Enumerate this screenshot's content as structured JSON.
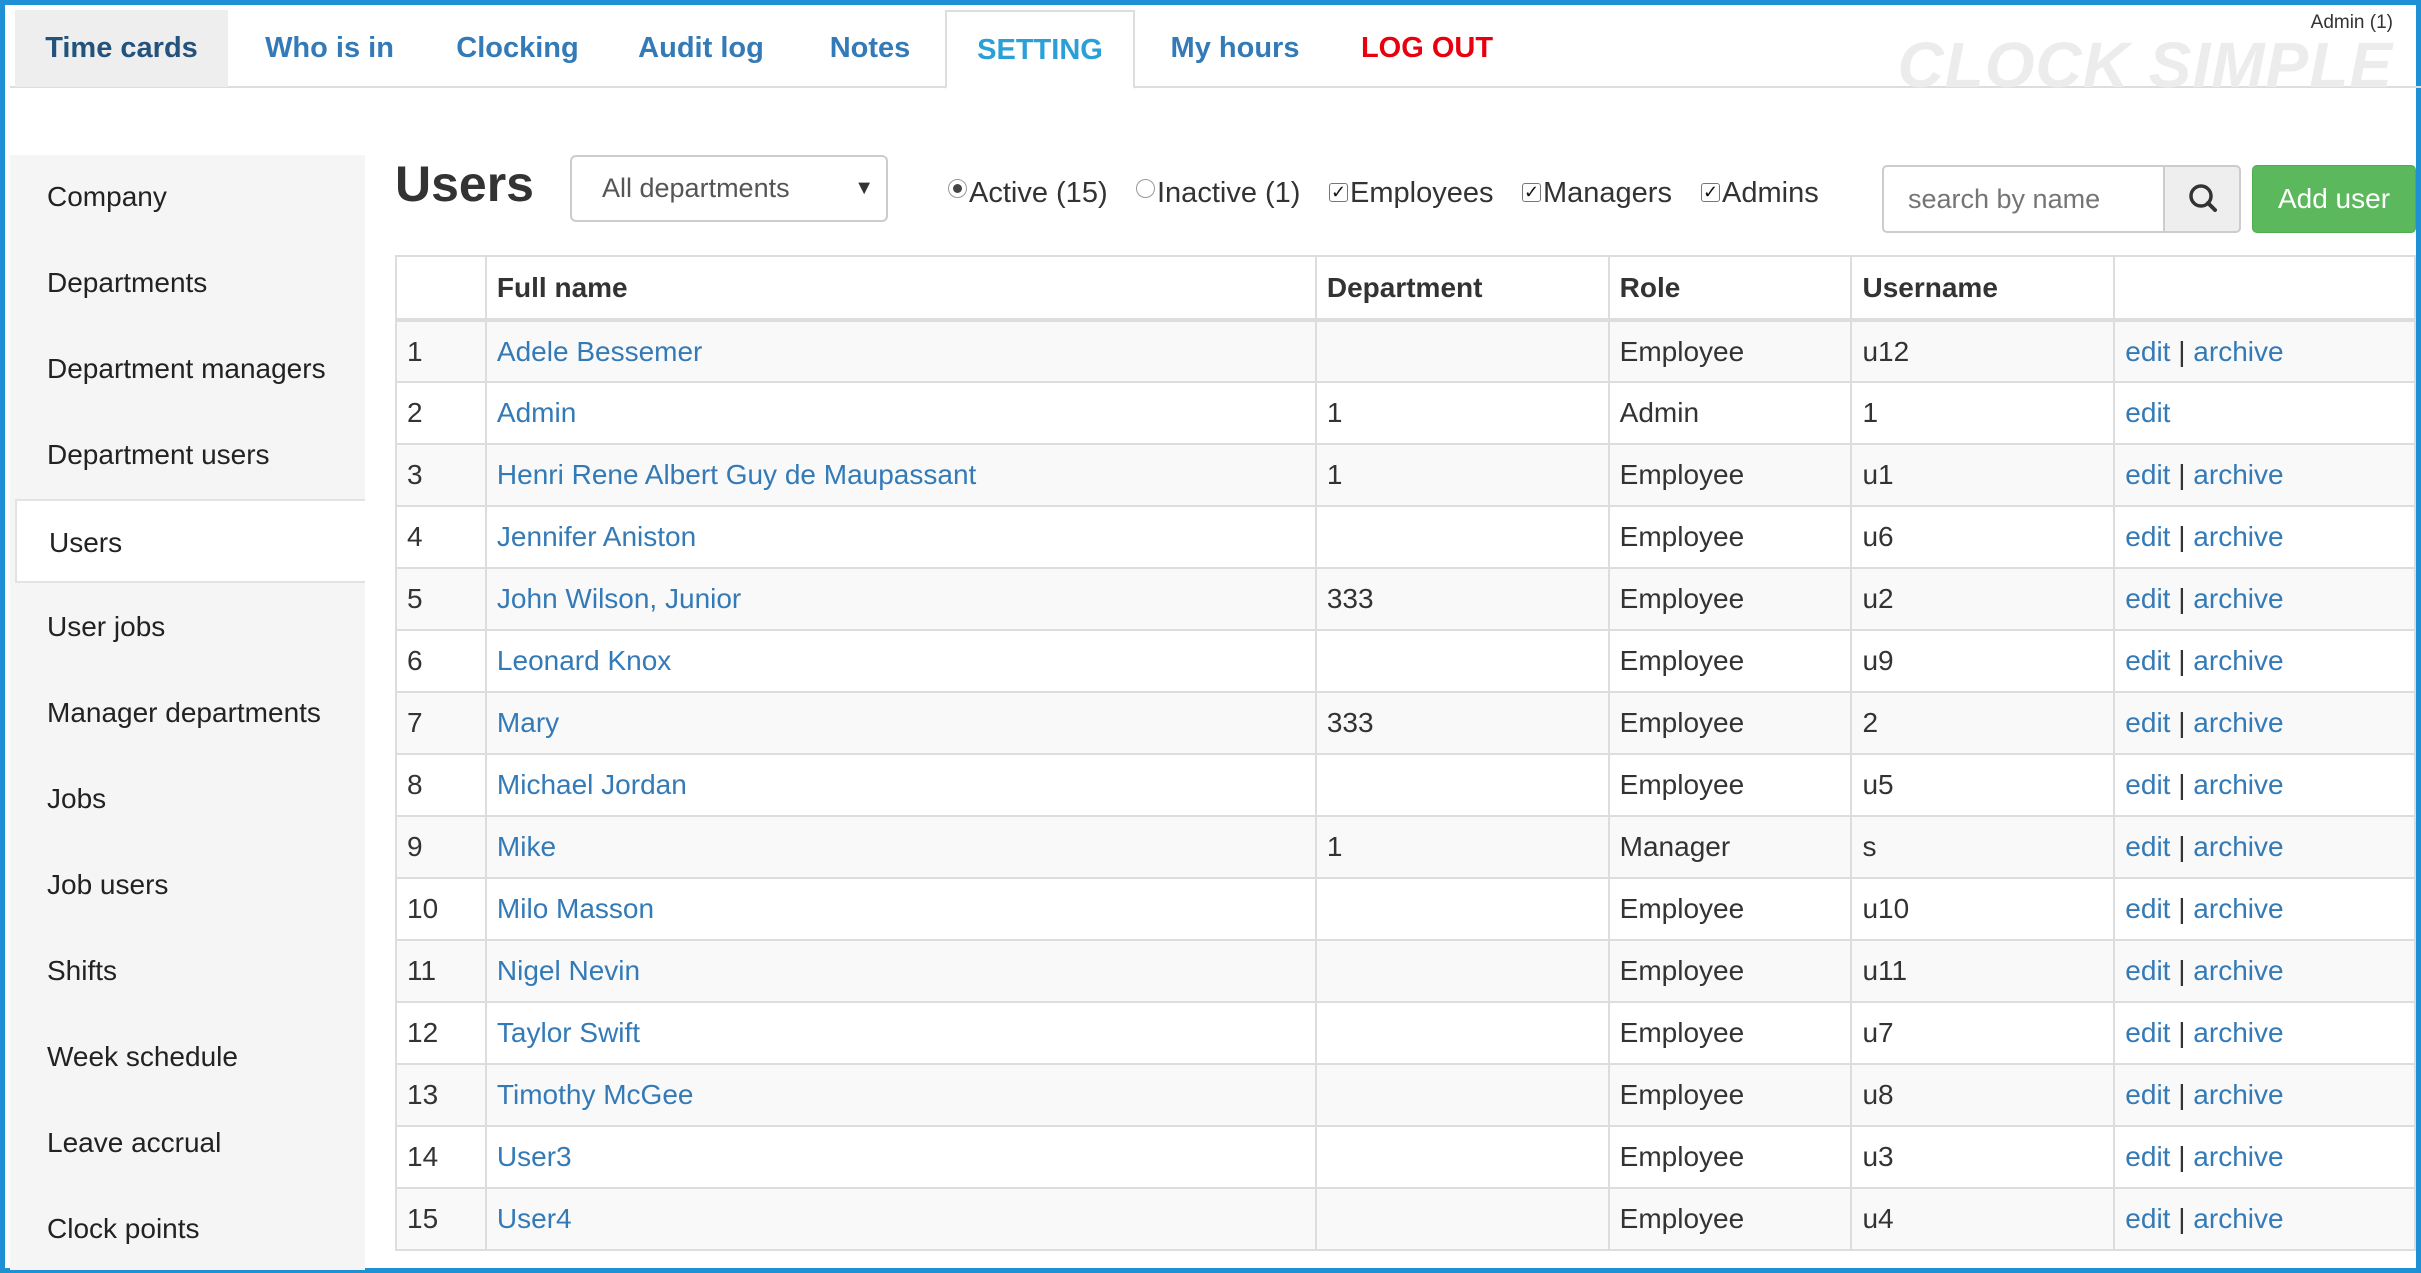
{
  "nav": {
    "tabs": [
      {
        "label": "Time cards"
      },
      {
        "label": "Who is in"
      },
      {
        "label": "Clocking"
      },
      {
        "label": "Audit log"
      },
      {
        "label": "Notes"
      },
      {
        "label": "SETTING"
      },
      {
        "label": "My hours"
      },
      {
        "label": "LOG OUT"
      }
    ],
    "current_user": "Admin (1)",
    "brand": "CLOCK SIMPLE"
  },
  "sidebar": {
    "items": [
      {
        "label": "Company"
      },
      {
        "label": "Departments"
      },
      {
        "label": "Department managers"
      },
      {
        "label": "Department users"
      },
      {
        "label": "Users"
      },
      {
        "label": "User jobs"
      },
      {
        "label": "Manager departments"
      },
      {
        "label": "Jobs"
      },
      {
        "label": "Job users"
      },
      {
        "label": "Shifts"
      },
      {
        "label": "Week schedule"
      },
      {
        "label": "Leave accrual"
      },
      {
        "label": "Clock points"
      }
    ],
    "active": "Users"
  },
  "page": {
    "title": "Users",
    "department_filter": "All departments",
    "filters": {
      "active": "Active (15)",
      "inactive": "Inactive (1)",
      "employees": "Employees",
      "managers": "Managers",
      "admins": "Admins"
    },
    "search_placeholder": "search by name",
    "add_user_label": "Add user"
  },
  "table": {
    "columns": [
      "",
      "Full name",
      "Department",
      "Role",
      "Username",
      ""
    ],
    "edit_label": "edit",
    "archive_label": "archive",
    "rows": [
      {
        "n": "1",
        "name": "Adele Bessemer",
        "dept": "",
        "role": "Employee",
        "username": "u12",
        "archive": true
      },
      {
        "n": "2",
        "name": "Admin",
        "dept": "1",
        "role": "Admin",
        "username": "1",
        "archive": false
      },
      {
        "n": "3",
        "name": "Henri Rene Albert Guy de Maupassant",
        "dept": "1",
        "role": "Employee",
        "username": "u1",
        "archive": true
      },
      {
        "n": "4",
        "name": "Jennifer Aniston",
        "dept": "",
        "role": "Employee",
        "username": "u6",
        "archive": true
      },
      {
        "n": "5",
        "name": "John Wilson, Junior",
        "dept": "333",
        "role": "Employee",
        "username": "u2",
        "archive": true
      },
      {
        "n": "6",
        "name": "Leonard Knox",
        "dept": "",
        "role": "Employee",
        "username": "u9",
        "archive": true
      },
      {
        "n": "7",
        "name": "Mary",
        "dept": "333",
        "role": "Employee",
        "username": "2",
        "archive": true
      },
      {
        "n": "8",
        "name": "Michael Jordan",
        "dept": "",
        "role": "Employee",
        "username": "u5",
        "archive": true
      },
      {
        "n": "9",
        "name": "Mike",
        "dept": "1",
        "role": "Manager",
        "username": "s",
        "archive": true
      },
      {
        "n": "10",
        "name": "Milo Masson",
        "dept": "",
        "role": "Employee",
        "username": "u10",
        "archive": true
      },
      {
        "n": "11",
        "name": "Nigel Nevin",
        "dept": "",
        "role": "Employee",
        "username": "u11",
        "archive": true
      },
      {
        "n": "12",
        "name": "Taylor Swift",
        "dept": "",
        "role": "Employee",
        "username": "u7",
        "archive": true
      },
      {
        "n": "13",
        "name": "Timothy McGee",
        "dept": "",
        "role": "Employee",
        "username": "u8",
        "archive": true
      },
      {
        "n": "14",
        "name": "User3",
        "dept": "",
        "role": "Employee",
        "username": "u3",
        "archive": true
      },
      {
        "n": "15",
        "name": "User4",
        "dept": "",
        "role": "Employee",
        "username": "u4",
        "archive": true
      }
    ]
  },
  "colors": {
    "frame": "#1e90d6",
    "link": "#337ab7",
    "active_tab": "#2a9fd8",
    "logout": "#e8000f",
    "add_button": "#5cb85c"
  }
}
